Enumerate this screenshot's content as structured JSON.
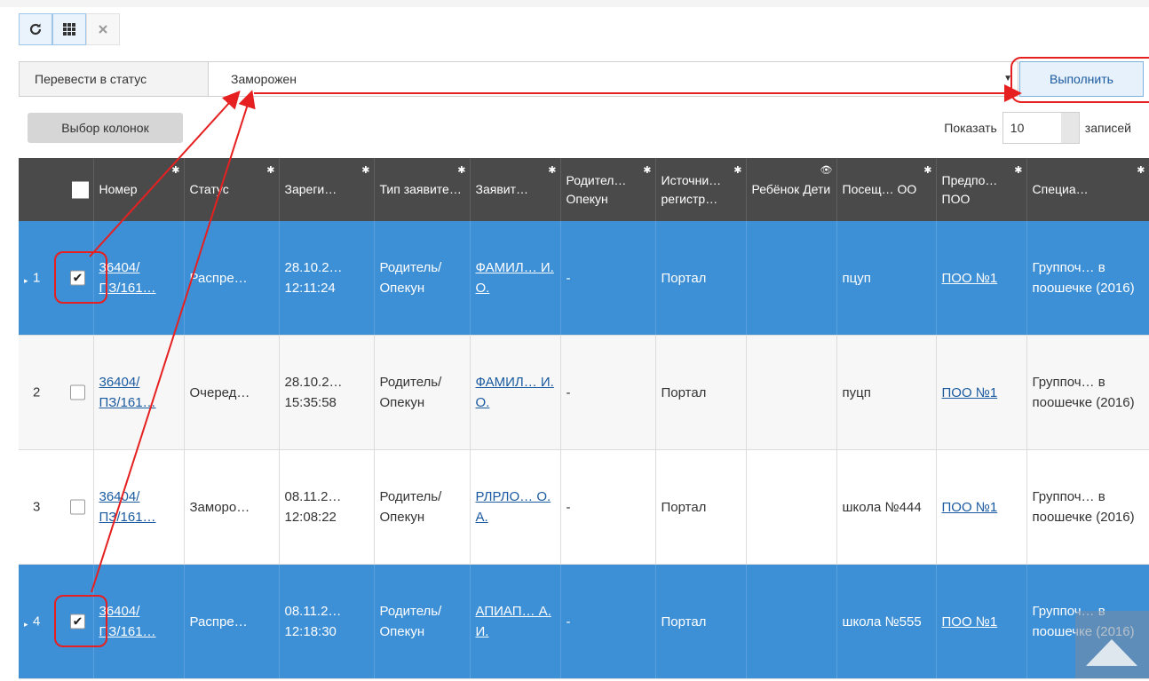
{
  "toolbar": {
    "refresh_icon": "refresh-icon",
    "grid_icon": "grid-icon",
    "close_icon": "close-icon"
  },
  "status_bar": {
    "label": "Перевести в статус",
    "selected": "Заморожен",
    "execute": "Выполнить"
  },
  "columns_button": "Выбор колонок",
  "paging": {
    "show_label": "Показать",
    "page_size": "10",
    "records_label": "записей"
  },
  "table": {
    "headers": [
      "Номер",
      "Статус",
      "Зареги…",
      "Тип заявите…",
      "Заявит…",
      "Родител… Опекун",
      "Источни… регистр…",
      "Ребёнок Дети",
      "Посещ… ОО",
      "Предпо… ПОО",
      "Специа…"
    ],
    "rows": [
      {
        "n": "1",
        "checked": true,
        "selected": true,
        "number": "36404/ ПЗ/161…",
        "status": "Распре…",
        "date": "28.10.2…",
        "time": "12:11:24",
        "type": "Родитель/ Опекун",
        "applicant": "ФАМИЛ… И. О.",
        "parent": "-",
        "source": "Портал",
        "child": "",
        "org": "пцуп",
        "pref": "ПОО №1",
        "spec": "Группоч… в поошечке (2016)"
      },
      {
        "n": "2",
        "checked": false,
        "selected": false,
        "number": "36404/ ПЗ/161…",
        "status": "Очеред…",
        "date": "28.10.2…",
        "time": "15:35:58",
        "type": "Родитель/ Опекун",
        "applicant": "ФАМИЛ… И. О.",
        "parent": "-",
        "source": "Портал",
        "child": "",
        "org": "пуцп",
        "pref": "ПОО №1",
        "spec": "Группоч… в поошечке (2016)"
      },
      {
        "n": "3",
        "checked": false,
        "selected": false,
        "number": "36404/ ПЗ/161…",
        "status": "Заморо…",
        "date": "08.11.2…",
        "time": "12:08:22",
        "type": "Родитель/ Опекун",
        "applicant": "РЛРЛО… О. А.",
        "parent": "-",
        "source": "Портал",
        "child": "",
        "org": "школа №444",
        "pref": "ПОО №1",
        "spec": "Группоч… в поошечке (2016)"
      },
      {
        "n": "4",
        "checked": true,
        "selected": true,
        "number": "36404/ ПЗ/161…",
        "status": "Распре…",
        "date": "08.11.2…",
        "time": "12:18:30",
        "type": "Родитель/ Опекун",
        "applicant": "АПИАП… А. И.",
        "parent": "-",
        "source": "Портал",
        "child": "",
        "org": "школа №555",
        "pref": "ПОО №1",
        "spec": "Группоч… в поошечке (2016)"
      }
    ]
  },
  "colors": {
    "selected_row": "#3d8fd6",
    "header_bg": "#4a4a4a",
    "annotation": "#e62020"
  }
}
